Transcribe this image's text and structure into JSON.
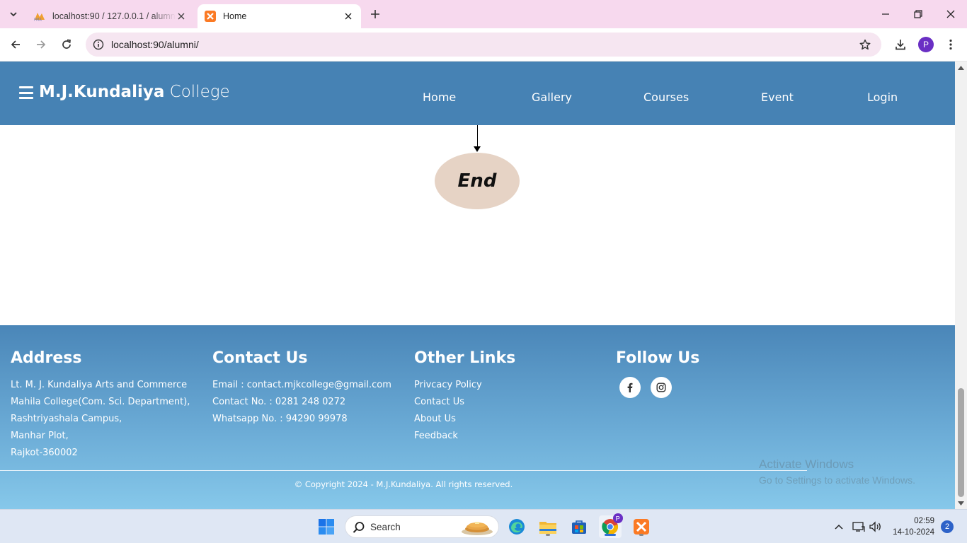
{
  "browser": {
    "tabs": [
      {
        "title": "localhost:90 / 127.0.0.1 / alumni",
        "active": false,
        "favicon": "phpmyadmin-icon"
      },
      {
        "title": "Home",
        "active": true,
        "favicon": "xampp-icon"
      }
    ],
    "address": "localhost:90/alumni/",
    "profile_initial": "P"
  },
  "site": {
    "brand_bold": "M.J.Kundaliya",
    "brand_light": "College",
    "nav": [
      "Home",
      "Gallery",
      "Courses",
      "Event",
      "Login"
    ]
  },
  "flowchart": {
    "end_label": "End"
  },
  "footer": {
    "address": {
      "heading": "Address",
      "lines": [
        "Lt. M. J. Kundaliya Arts and Commerce",
        "Mahila College(Com. Sci. Department),",
        "Rashtriyashala Campus,",
        "Manhar Plot,",
        "Rajkot-360002"
      ]
    },
    "contact": {
      "heading": "Contact Us",
      "lines": [
        "Email : contact.mjkcollege@gmail.com",
        "Contact No. : 0281 248 0272",
        "Whatsapp No. : 94290 99978"
      ]
    },
    "links": {
      "heading": "Other Links",
      "items": [
        "Privcacy Policy",
        "Contact Us",
        "About Us",
        "Feedback"
      ]
    },
    "follow": {
      "heading": "Follow Us",
      "icons": [
        "facebook-icon",
        "instagram-icon"
      ]
    },
    "copyright": "© Copyright 2024 - M.J.Kundaliya. All rights reserved."
  },
  "watermark": {
    "line1": "Activate Windows",
    "line2": "Go to Settings to activate Windows."
  },
  "taskbar": {
    "search_placeholder": "Search",
    "time": "02:59",
    "date": "14-10-2024",
    "notifications": "2"
  },
  "colors": {
    "nav_bg": "#4682b4",
    "end_node": "#e6d3c5",
    "tabstrip": "#f7d9ee"
  }
}
